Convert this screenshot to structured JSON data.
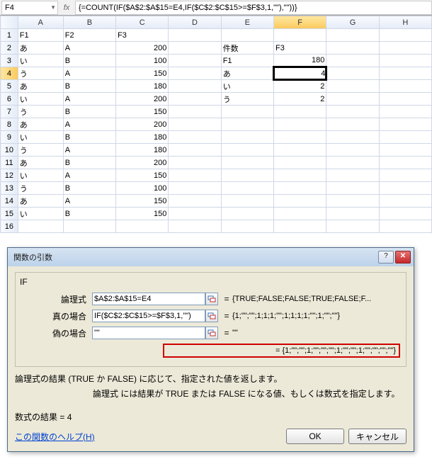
{
  "nameBox": "F4",
  "formula": "{=COUNT(IF($A$2:$A$15=E4,IF($C$2:$C$15>=$F$3,1,\"\"),\"\"))}",
  "cols": [
    "A",
    "B",
    "C",
    "D",
    "E",
    "F",
    "G",
    "H"
  ],
  "activeCol": "F",
  "activeRow": 4,
  "rows": [
    {
      "n": 1,
      "A": "F1",
      "B": "F2",
      "C": "F3",
      "boldABC": true
    },
    {
      "n": 2,
      "A": "あ",
      "B": "A",
      "Cn": 200,
      "E": "件数",
      "F": "F3",
      "boldEF": true
    },
    {
      "n": 3,
      "A": "い",
      "B": "B",
      "Cn": 100,
      "E": "F1",
      "Fn": 180,
      "boldE": true
    },
    {
      "n": 4,
      "A": "う",
      "B": "A",
      "Cn": 150,
      "E": "あ",
      "Fn": 4,
      "active": true
    },
    {
      "n": 5,
      "A": "あ",
      "B": "B",
      "Cn": 180,
      "E": "い",
      "Fn": 2
    },
    {
      "n": 6,
      "A": "い",
      "B": "A",
      "Cn": 200,
      "E": "う",
      "Fn": 2
    },
    {
      "n": 7,
      "A": "う",
      "B": "B",
      "Cn": 150
    },
    {
      "n": 8,
      "A": "あ",
      "B": "A",
      "Cn": 200
    },
    {
      "n": 9,
      "A": "い",
      "B": "B",
      "Cn": 180
    },
    {
      "n": 10,
      "A": "う",
      "B": "A",
      "Cn": 180
    },
    {
      "n": 11,
      "A": "あ",
      "B": "B",
      "Cn": 200
    },
    {
      "n": 12,
      "A": "い",
      "B": "A",
      "Cn": 150
    },
    {
      "n": 13,
      "A": "う",
      "B": "B",
      "Cn": 100
    },
    {
      "n": 14,
      "A": "あ",
      "B": "A",
      "Cn": 150
    },
    {
      "n": 15,
      "A": "い",
      "B": "B",
      "Cn": 150
    },
    {
      "n": 16
    }
  ],
  "dialog": {
    "title": "関数の引数",
    "fn": "IF",
    "args": [
      {
        "label": "論理式",
        "value": "$A$2:$A$15=E4",
        "preview": "{TRUE;FALSE;FALSE;TRUE;FALSE;F..."
      },
      {
        "label": "真の場合",
        "value": "IF($C$2:$C$15>=$F$3,1,\"\")",
        "preview": "{1;\"\";\"\";1;1;1;\"\";1;1;1;1;\"\";1;\"\";\"\"}"
      },
      {
        "label": "偽の場合",
        "value": "\"\"",
        "preview": "\"\""
      }
    ],
    "resultPreview": "= {1;\"\";\"\";1;\"\";\"\";\"\";1;\"\";\"\";1;\"\";\"\";\"\";\"\"}",
    "desc1": "論理式の結果 (TRUE か FALSE) に応じて、指定された値を返します。",
    "desc2": "論理式  には結果が TRUE または FALSE になる値、もしくは数式を指定します。",
    "formulaResultLabel": "数式の結果 = ",
    "formulaResultValue": "4",
    "helpText": "この関数のヘルプ(H)",
    "ok": "OK",
    "cancel": "キャンセル"
  }
}
